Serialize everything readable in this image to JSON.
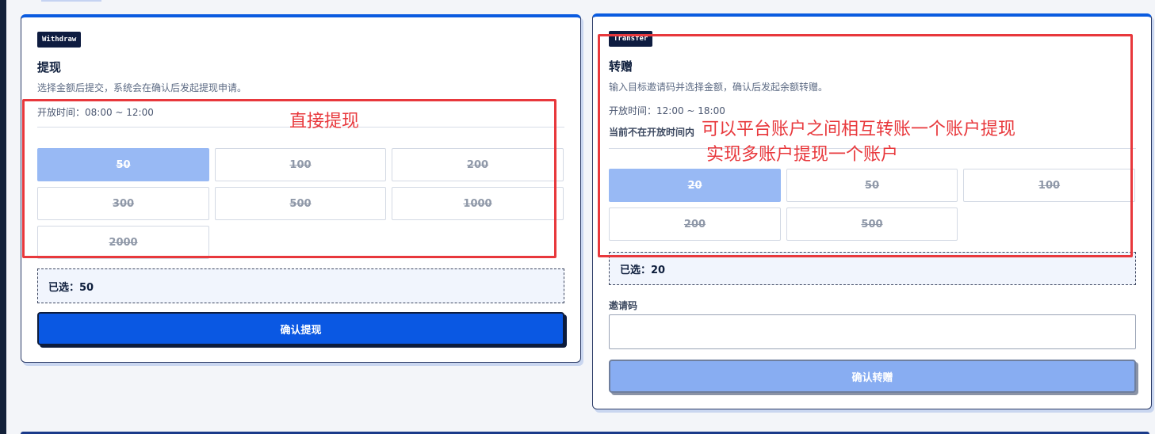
{
  "withdraw": {
    "badge": "Withdraw",
    "title": "提现",
    "description": "选择金额后提交，系统会在确认后发起提现申请。",
    "hours": "开放时间：08:00 ~ 12:00",
    "amounts": [
      "50",
      "100",
      "200",
      "300",
      "500",
      "1000",
      "2000"
    ],
    "selected_index": 0,
    "selected_text": "已选：50",
    "confirm_label": "确认提现"
  },
  "transfer": {
    "badge": "Transfer",
    "title": "转赠",
    "description": "输入目标邀请码并选择金额，确认后发起余额转赠。",
    "hours": "开放时间：12:00 ~ 18:00",
    "closed_note": "当前不在开放时间内",
    "amounts": [
      "20",
      "50",
      "100",
      "200",
      "500"
    ],
    "selected_index": 0,
    "selected_text": "已选：20",
    "invite_label": "邀请码",
    "invite_value": "",
    "confirm_label": "确认转赠"
  },
  "annotations": {
    "left_text": "直接提现",
    "right_line1": "可以平台账户之间相互转账一个账户提现",
    "right_line2": "实现多账户提现一个账户",
    "color": "#e8383c"
  },
  "colors": {
    "primary": "#0a58e3",
    "selected_amount": "#98b9f4",
    "disabled_button": "#88adf2",
    "badge_bg": "#0e1c40"
  }
}
